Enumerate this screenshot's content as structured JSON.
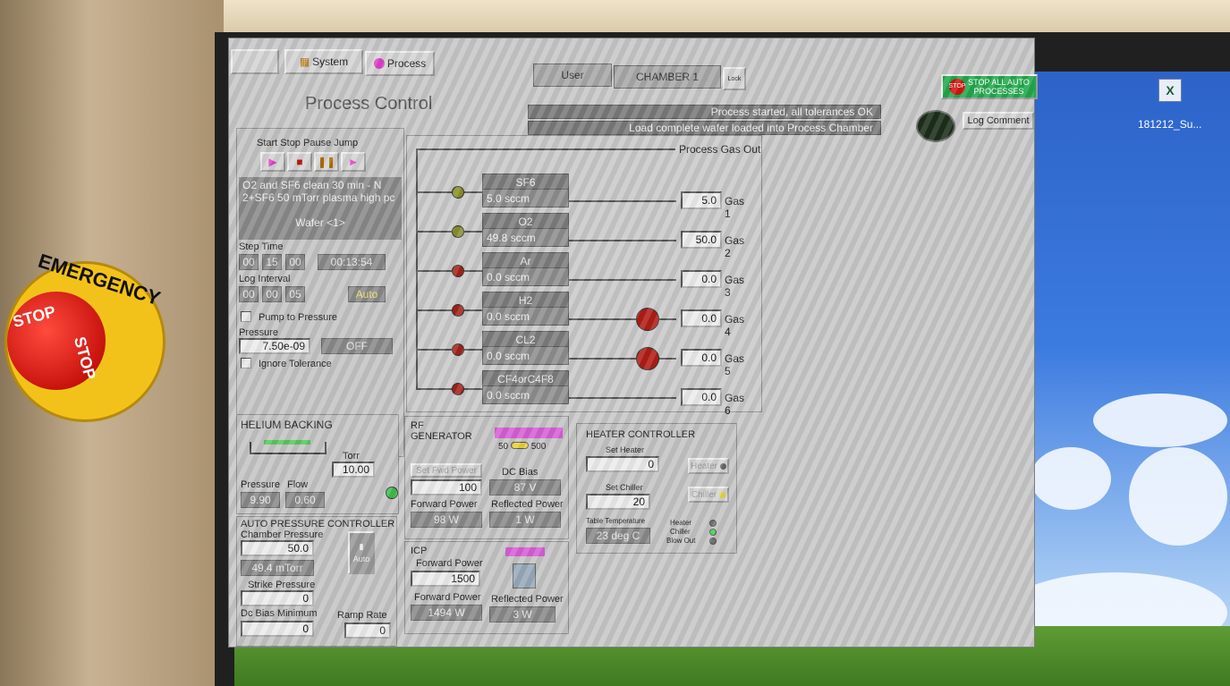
{
  "nav": {
    "system": "System",
    "process": "Process"
  },
  "header": {
    "user_label": "User",
    "chamber": "CHAMBER 1",
    "lock_label": "Lock",
    "stop_all": "STOP ALL AUTO PROCESSES",
    "stop_badge": "STOP",
    "title": "Process Control",
    "log_comment": "Log Comment"
  },
  "messages": [
    "Process started, all tolerances OK",
    "Load complete wafer loaded into Process Chamber"
  ],
  "recipe": {
    "controls": [
      "Start",
      "Stop",
      "Pause",
      "Jump"
    ],
    "text_line1": "O2 and SF6 clean 30 min - N",
    "text_line2": "2+SF6 50 mTorr plasma high pc",
    "wafer": "Wafer <1>",
    "step_time_label": "Step Time",
    "step_time": [
      "00",
      "15",
      "00"
    ],
    "elapsed": "00:13:54",
    "log_interval_label": "Log Interval",
    "log_interval": [
      "00",
      "00",
      "05"
    ],
    "auto_button": "Auto",
    "pump_to_pressure": "Pump to Pressure",
    "pressure_label": "Pressure",
    "pressure": "7.50e-09",
    "pressure_state": "OFF",
    "ignore_tolerance": "Ignore Tolerance"
  },
  "gas_panel": {
    "outlet": "Process Gas Out",
    "lines": [
      {
        "name": "SF6",
        "flow": "5.0 sccm",
        "setpoint": "5.0",
        "label": "Gas 1",
        "valve_color": "#8a8f2c"
      },
      {
        "name": "O2",
        "flow": "49.8 sccm",
        "setpoint": "50.0",
        "label": "Gas 2",
        "valve_color": "#8a8f2c"
      },
      {
        "name": "Ar",
        "flow": "0.0 sccm",
        "setpoint": "0.0",
        "label": "Gas 3",
        "valve_color": "#a3231c"
      },
      {
        "name": "H2",
        "flow": "0.0 sccm",
        "setpoint": "0.0",
        "label": "Gas 4",
        "valve_color": "#a3231c"
      },
      {
        "name": "CL2",
        "flow": "0.0 sccm",
        "setpoint": "0.0",
        "label": "Gas 5",
        "valve_color": "#a3231c"
      },
      {
        "name": "CF4orC4F8",
        "flow": "0.0 sccm",
        "setpoint": "0.0",
        "label": "Gas 6",
        "valve_color": "#a3231c"
      }
    ]
  },
  "helium": {
    "title": "HELIUM BACKING",
    "torr_label": "Torr",
    "torr": "10.00",
    "pressure_label": "Pressure",
    "flow_label": "Flow",
    "pressure": "9.90",
    "flow": "0.60"
  },
  "apc": {
    "title": "AUTO PRESSURE CONTROLLER",
    "chamber_pressure_label": "Chamber Pressure",
    "chamber_pressure_set": "50.0",
    "chamber_pressure_read": "49.4 mTorr",
    "mode": "Auto",
    "strike_pressure_label": "Strike Pressure",
    "strike_pressure": "0",
    "dc_bias_min_label": "Dc Bias Minimum",
    "dc_bias_min": "0",
    "ramp_rate_label": "Ramp Rate",
    "ramp_rate": "0"
  },
  "rf": {
    "title_line1": "RF",
    "title_line2": "GENERATOR",
    "freq_low": "50",
    "freq_high": "500",
    "set_fwd_power_btn": "Set Fwd Power",
    "set_fwd_power": "100",
    "dc_bias_label": "DC Bias",
    "dc_bias": "87 V",
    "forward_power_label": "Forward Power",
    "forward_power": "98 W",
    "reflected_power_label": "Reflected Power",
    "reflected_power": "1 W"
  },
  "icp": {
    "title": "ICP",
    "forward_power_label": "Forward Power",
    "forward_power_set": "1500",
    "forward_power_read_label": "Forward Power",
    "forward_power_read": "1494 W",
    "reflected_power_label": "Reflected Power",
    "reflected_power": "3 W"
  },
  "heater": {
    "title": "HEATER CONTROLLER",
    "set_heater_label": "Set Heater",
    "set_heater": "0",
    "heater_btn": "Heater",
    "set_chiller_label": "Set Chiller",
    "set_chiller": "20",
    "chiller_btn": "Chiller",
    "table_temp_label": "Table Temperature",
    "table_temp": "23 deg C",
    "status_heater": "Heater",
    "status_chiller": "Chiller",
    "status_blowout": "Blow Out"
  },
  "desktop": {
    "icon_label": "181212_Su..."
  },
  "emergency": {
    "ring_text": "EMERGENCY",
    "stop": "STOP"
  },
  "colors": {
    "stop_green": "#1fa64a",
    "process_magenta": "#e040c8",
    "alarm_red": "#b01e16"
  }
}
